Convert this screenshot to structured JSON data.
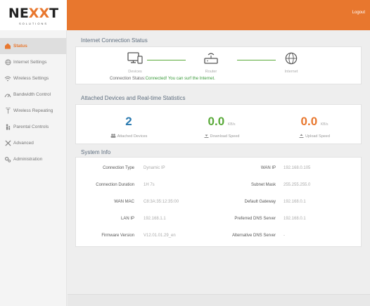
{
  "brand": {
    "name": "NEXXT",
    "tagline": "SOLUTIONS"
  },
  "header": {
    "logout_label": "Logout"
  },
  "sidebar": {
    "items": [
      {
        "label": "Status",
        "icon": "house-icon"
      },
      {
        "label": "Internet Settings",
        "icon": "globe-icon"
      },
      {
        "label": "Wireless Settings",
        "icon": "wifi-icon"
      },
      {
        "label": "Bandwidth Control",
        "icon": "gauge-icon"
      },
      {
        "label": "Wireless Repeating",
        "icon": "repeater-icon"
      },
      {
        "label": "Parental Controls",
        "icon": "parent-icon"
      },
      {
        "label": "Advanced",
        "icon": "tools-icon"
      },
      {
        "label": "Administration",
        "icon": "gears-icon"
      }
    ]
  },
  "connection": {
    "title": "Internet Connection Status",
    "devices_label": "Devices",
    "router_label": "Router",
    "internet_label": "Internet",
    "status_prefix": "Connection Status:",
    "status_text": "Connected! You can surf the Internet."
  },
  "stats": {
    "title": "Attached Devices and Real-time Statistics",
    "attached_count": "2",
    "attached_label": "Attached Devices",
    "download_value": "0.0",
    "download_unit": "KB/s",
    "download_label": "Download Speed",
    "upload_value": "0.0",
    "upload_unit": "KB/s",
    "upload_label": "Upload Speed"
  },
  "system_info": {
    "title": "System Info",
    "left": [
      {
        "key": "Connection Type",
        "value": "Dynamic IP"
      },
      {
        "key": "Connection Duration",
        "value": "1H 7s"
      },
      {
        "key": "WAN MAC",
        "value": "C8:3A:35:12:35:00"
      },
      {
        "key": "LAN IP",
        "value": "192.168.1.1"
      },
      {
        "key": "Firmware Version",
        "value": "V12.01.01.29_en"
      }
    ],
    "right": [
      {
        "key": "WAN IP",
        "value": "192.168.0.105"
      },
      {
        "key": "Subnet Mask",
        "value": "255.255.255.0"
      },
      {
        "key": "Default Gateway",
        "value": "192.168.0.1"
      },
      {
        "key": "Preferred DNS Server",
        "value": "192.168.0.1"
      },
      {
        "key": "Alternative DNS Server",
        "value": "-"
      }
    ]
  },
  "colors": {
    "accent": "#e8772e",
    "ok": "#3a9a3a",
    "download": "#5aaa3a",
    "upload": "#e8772e",
    "count": "#2a7ab0"
  }
}
